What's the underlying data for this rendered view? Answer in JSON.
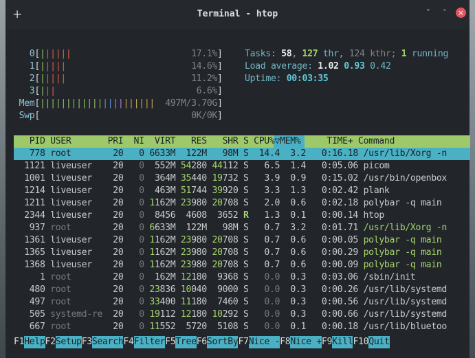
{
  "window": {
    "title": "Terminal - htop",
    "new_tab_label": "+",
    "minimize_label": "ˇ",
    "maximize_label": "ˆ",
    "close_label": "×"
  },
  "meters": {
    "cpu": [
      {
        "id": "0",
        "bars": "||||||",
        "pct": "17.1%"
      },
      {
        "id": "1",
        "bars": "|||||",
        "pct": "14.6%"
      },
      {
        "id": "2",
        "bars": "|||||",
        "pct": "11.2%"
      },
      {
        "id": "3",
        "bars": "|||",
        "pct": "6.6%"
      }
    ],
    "mem": {
      "label": "Mem",
      "bars": "||||||||||||||||||||||",
      "value": "497M/3.70G"
    },
    "swp": {
      "label": "Swp",
      "bars": "",
      "value": "0K/0K"
    },
    "tasks": {
      "label": "Tasks:",
      "count": "58",
      "thr": "127",
      "thr_label": "thr,",
      "kthr": "124",
      "kthr_label": "kthr;",
      "running": "1",
      "running_label": "running"
    },
    "load": {
      "label": "Load average:",
      "l1": "1.02",
      "l5": "0.93",
      "l15": "0.42"
    },
    "uptime": {
      "label": "Uptime:",
      "value": "00:03:35"
    }
  },
  "table": {
    "columns": [
      "PID",
      "USER",
      "PRI",
      "NI",
      "VIRT",
      "RES",
      "SHR",
      "S",
      "CPU%▽",
      "MEM%",
      "TIME+",
      "Command"
    ],
    "rows": [
      {
        "pid": "778",
        "user": "root",
        "pri": "20",
        "ni": "0",
        "virt": "6633M",
        "res": "122M",
        "shr": "98M",
        "s": "S",
        "cpu": "14.4",
        "mem": "3.2",
        "time": "0:16.18",
        "cmd": "/usr/lib/Xorg -n"
      },
      {
        "pid": "1121",
        "user": "liveuser",
        "pri": "20",
        "ni": "0",
        "virt": "552M",
        "res": "54280",
        "shr": "44112",
        "s": "S",
        "cpu": "6.5",
        "mem": "1.4",
        "time": "0:05.06",
        "cmd": "picom"
      },
      {
        "pid": "1001",
        "user": "liveuser",
        "pri": "20",
        "ni": "0",
        "virt": "364M",
        "res": "35440",
        "shr": "19732",
        "s": "S",
        "cpu": "3.9",
        "mem": "0.9",
        "time": "0:15.02",
        "cmd": "/usr/bin/openbox"
      },
      {
        "pid": "1214",
        "user": "liveuser",
        "pri": "20",
        "ni": "0",
        "virt": "463M",
        "res": "51744",
        "shr": "39920",
        "s": "S",
        "cpu": "3.3",
        "mem": "1.3",
        "time": "0:02.42",
        "cmd": "plank"
      },
      {
        "pid": "1211",
        "user": "liveuser",
        "pri": "20",
        "ni": "0",
        "virt": "1162M",
        "res": "23980",
        "shr": "20708",
        "s": "S",
        "cpu": "2.0",
        "mem": "0.6",
        "time": "0:02.18",
        "cmd": "polybar -q main"
      },
      {
        "pid": "2344",
        "user": "liveuser",
        "pri": "20",
        "ni": "0",
        "virt": "8456",
        "res": "4608",
        "shr": "3652",
        "s": "R",
        "cpu": "1.3",
        "mem": "0.1",
        "time": "0:00.14",
        "cmd": "htop"
      },
      {
        "pid": "937",
        "user": "root",
        "pri": "20",
        "ni": "0",
        "virt": "6633M",
        "res": "122M",
        "shr": "98M",
        "s": "S",
        "cpu": "0.7",
        "mem": "3.2",
        "time": "0:01.71",
        "cmd": "/usr/lib/Xorg -n"
      },
      {
        "pid": "1361",
        "user": "liveuser",
        "pri": "20",
        "ni": "0",
        "virt": "1162M",
        "res": "23980",
        "shr": "20708",
        "s": "S",
        "cpu": "0.7",
        "mem": "0.6",
        "time": "0:00.05",
        "cmd": "polybar -q main"
      },
      {
        "pid": "1365",
        "user": "liveuser",
        "pri": "20",
        "ni": "0",
        "virt": "1162M",
        "res": "23980",
        "shr": "20708",
        "s": "S",
        "cpu": "0.7",
        "mem": "0.6",
        "time": "0:00.29",
        "cmd": "polybar -q main"
      },
      {
        "pid": "1368",
        "user": "liveuser",
        "pri": "20",
        "ni": "0",
        "virt": "1162M",
        "res": "23980",
        "shr": "20708",
        "s": "S",
        "cpu": "0.7",
        "mem": "0.6",
        "time": "0:00.09",
        "cmd": "polybar -q main"
      },
      {
        "pid": "1",
        "user": "root",
        "pri": "20",
        "ni": "0",
        "virt": "162M",
        "res": "12180",
        "shr": "9368",
        "s": "S",
        "cpu": "0.0",
        "mem": "0.3",
        "time": "0:03.06",
        "cmd": "/sbin/init"
      },
      {
        "pid": "480",
        "user": "root",
        "pri": "20",
        "ni": "0",
        "virt": "23836",
        "res": "10040",
        "shr": "9000",
        "s": "S",
        "cpu": "0.0",
        "mem": "0.3",
        "time": "0:00.26",
        "cmd": "/usr/lib/systemd"
      },
      {
        "pid": "497",
        "user": "root",
        "pri": "20",
        "ni": "0",
        "virt": "33400",
        "res": "11180",
        "shr": "7460",
        "s": "S",
        "cpu": "0.0",
        "mem": "0.3",
        "time": "0:00.56",
        "cmd": "/usr/lib/systemd"
      },
      {
        "pid": "505",
        "user": "systemd-re",
        "pri": "20",
        "ni": "0",
        "virt": "19112",
        "res": "12180",
        "shr": "10292",
        "s": "S",
        "cpu": "0.0",
        "mem": "0.3",
        "time": "0:00.66",
        "cmd": "/usr/lib/systemd"
      },
      {
        "pid": "667",
        "user": "root",
        "pri": "20",
        "ni": "0",
        "virt": "11552",
        "res": "5720",
        "shr": "5108",
        "s": "S",
        "cpu": "0.0",
        "mem": "0.1",
        "time": "0:00.18",
        "cmd": "/usr/lib/bluetoo"
      }
    ]
  },
  "fkeys": [
    {
      "key": "F1",
      "label": "Help  "
    },
    {
      "key": "F2",
      "label": "Setup "
    },
    {
      "key": "F3",
      "label": "Search"
    },
    {
      "key": "F4",
      "label": "Filter"
    },
    {
      "key": "F5",
      "label": "Tree  "
    },
    {
      "key": "F6",
      "label": "SortBy"
    },
    {
      "key": "F7",
      "label": "Nice -"
    },
    {
      "key": "F8",
      "label": "Nice +"
    },
    {
      "key": "F9",
      "label": "Kill  "
    },
    {
      "key": "F10",
      "label": "Quit"
    }
  ],
  "colors": {
    "accent_cyan": "#4ab0c3",
    "header_green": "#9ec96a",
    "terminal_bg": "#22262a",
    "close_red": "#e05560"
  }
}
